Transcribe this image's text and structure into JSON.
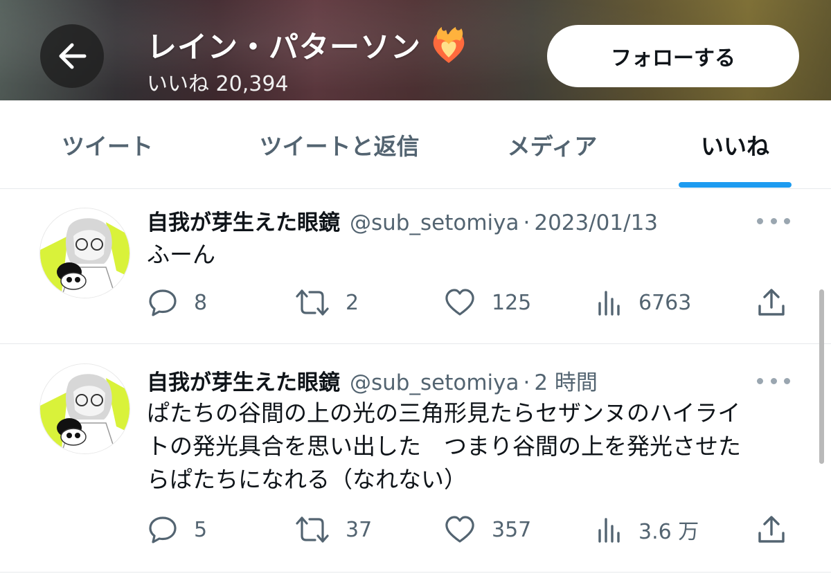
{
  "header": {
    "back_icon": "arrow-left-icon",
    "title": "レイン・パターソン",
    "title_emoji": "heart-on-fire-icon",
    "likes_count": "いいね 20,394",
    "follow_label": "フォローする"
  },
  "tabs": [
    {
      "label": "ツイート",
      "active": false
    },
    {
      "label": "ツイートと返信",
      "active": false
    },
    {
      "label": "メディア",
      "active": false
    },
    {
      "label": "いいね",
      "active": true
    }
  ],
  "accent_color": "#1d9bf0",
  "tweets": [
    {
      "name": "自我が芽生えた眼鏡",
      "handle": "@sub_setomiya",
      "separator": "·",
      "time": "2023/01/13",
      "text_lines": [
        "ふーん"
      ],
      "replies": "8",
      "retweets": "2",
      "likes": "125",
      "views": "6763"
    },
    {
      "name": "自我が芽生えた眼鏡",
      "handle": "@sub_setomiya",
      "separator": "·",
      "time": "2 時間",
      "text_lines": [
        "ぱたちの谷間の上の光の三角形見たらセザンヌのハイライ",
        "トの発光具合を思い出した　つまり谷間の上を発光させた",
        "らぱたちになれる（なれない）"
      ],
      "replies": "5",
      "retweets": "37",
      "likes": "357",
      "views": "3.6 万"
    }
  ],
  "icons": {
    "reply": "speech-bubble-icon",
    "retweet": "retweet-arrows-icon",
    "like": "heart-outline-icon",
    "views": "bar-chart-icon",
    "share": "share-upload-icon",
    "more": "more-dots-icon"
  }
}
